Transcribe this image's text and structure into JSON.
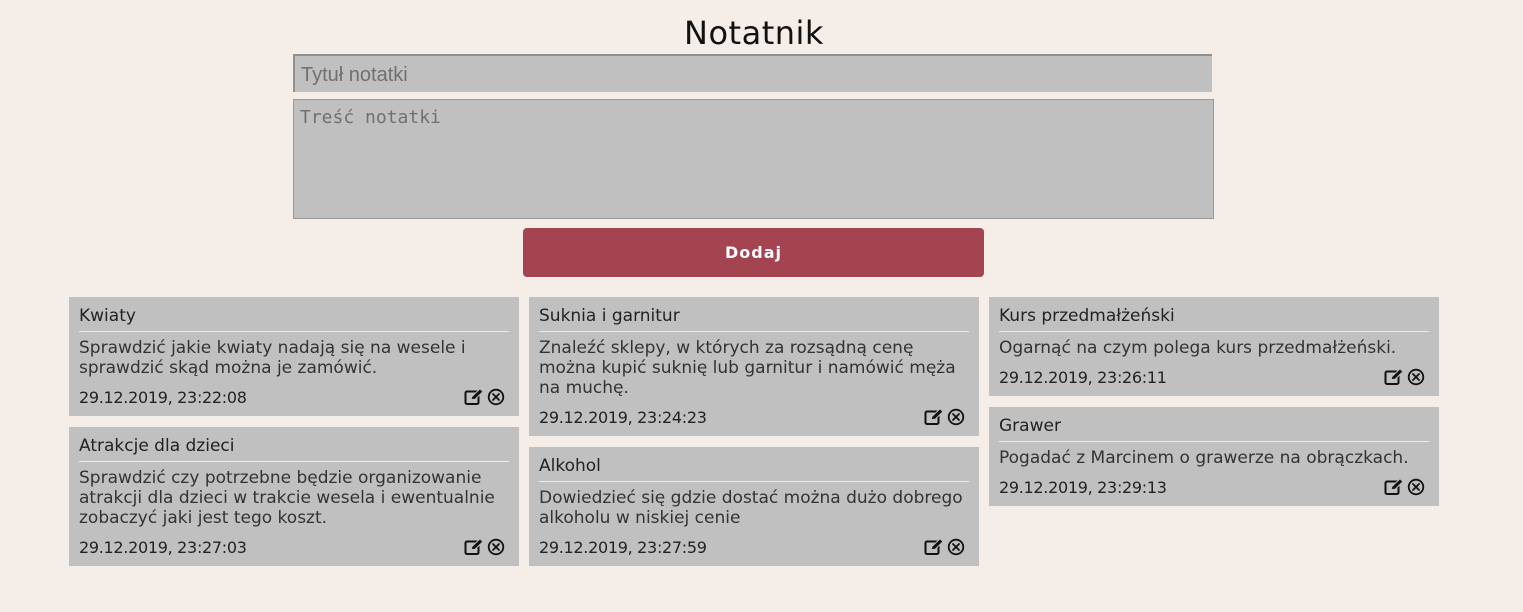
{
  "app": {
    "title": "Notatnik"
  },
  "form": {
    "title_placeholder": "Tytuł notatki",
    "title_value": "",
    "content_placeholder": "Treść notatki",
    "content_value": "",
    "add_label": "Dodaj"
  },
  "columns": [
    {
      "notes": [
        {
          "title": "Kwiaty",
          "body": "Sprawdzić jakie kwiaty nadają się na wesele i sprawdzić skąd można je zamówić.",
          "date": "29.12.2019, 23:22:08"
        },
        {
          "title": "Atrakcje dla dzieci",
          "body": "Sprawdzić czy potrzebne będzie organizowanie atrakcji dla dzieci w trakcie wesela i ewentualnie zobaczyć jaki jest tego koszt.",
          "date": "29.12.2019, 23:27:03"
        }
      ]
    },
    {
      "notes": [
        {
          "title": "Suknia i garnitur",
          "body": "Znaleźć sklepy, w których za rozsądną cenę można kupić suknię lub garnitur i namówić męża na muchę.",
          "date": "29.12.2019, 23:24:23"
        },
        {
          "title": "Alkohol",
          "body": "Dowiedzieć się gdzie dostać można dużo dobrego alkoholu w niskiej cenie",
          "date": "29.12.2019, 23:27:59"
        }
      ]
    },
    {
      "notes": [
        {
          "title": "Kurs przedmałżeński",
          "body": "Ogarnąć na czym polega kurs przedmałżeński.",
          "date": "29.12.2019, 23:26:11"
        },
        {
          "title": "Grawer",
          "body": "Pogadać z Marcinem o grawerze na obrączkach.",
          "date": "29.12.2019, 23:29:13"
        }
      ]
    }
  ],
  "icons": {
    "edit": "edit-icon",
    "delete": "delete-icon"
  },
  "colors": {
    "background": "#f5ede7",
    "card": "#c0c0c0",
    "accent": "#a54451"
  }
}
